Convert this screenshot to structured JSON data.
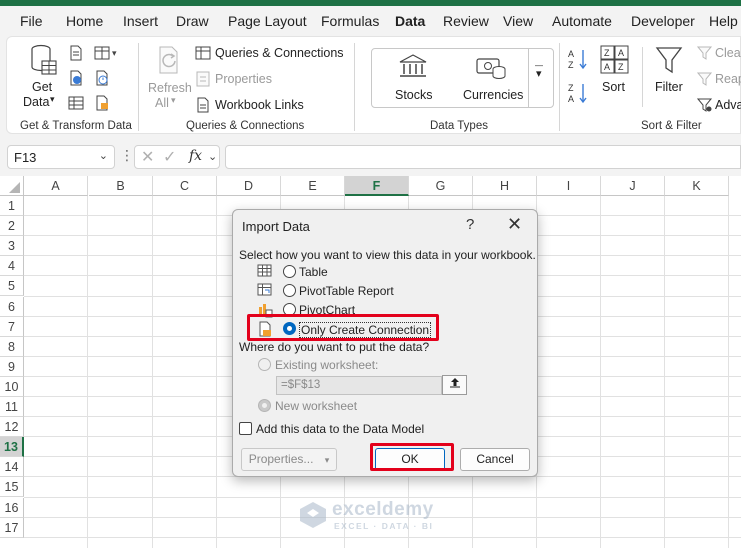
{
  "menu": {
    "tabs": [
      "File",
      "Home",
      "Insert",
      "Draw",
      "Page Layout",
      "Formulas",
      "Data",
      "Review",
      "View",
      "Automate",
      "Developer",
      "Help"
    ],
    "active_tab": "Data",
    "accent_color": "#1e7145"
  },
  "ribbon": {
    "get_transform": {
      "get_data_label": "Get",
      "get_data_label2": "Data",
      "group_label": "Get & Transform Data"
    },
    "queries": {
      "refresh_label": "Refresh",
      "refresh_all_label": "All",
      "queries_connections": "Queries & Connections",
      "properties": "Properties",
      "workbook_links": "Workbook Links",
      "group_label": "Queries & Connections"
    },
    "data_types": {
      "stocks": "Stocks",
      "currencies": "Currencies",
      "group_label": "Data Types"
    },
    "sort_filter": {
      "sort": "Sort",
      "filter": "Filter",
      "clear": "Clear",
      "reapply": "Reap",
      "advanced": "Adva",
      "group_label": "Sort & Filter"
    }
  },
  "formula_bar": {
    "name_box": "F13",
    "fx": "fx",
    "formula": ""
  },
  "grid": {
    "columns": [
      "A",
      "B",
      "C",
      "D",
      "E",
      "F",
      "G",
      "H",
      "I",
      "J",
      "K"
    ],
    "rows": [
      "1",
      "2",
      "3",
      "4",
      "5",
      "6",
      "7",
      "8",
      "9",
      "10",
      "11",
      "12",
      "13",
      "14",
      "15",
      "16",
      "17"
    ],
    "selected_column": "F",
    "selected_row": "13"
  },
  "dialog": {
    "title": "Import Data",
    "help": "?",
    "close": "✕",
    "view_prompt": "Select how you want to view this data in your workbook.",
    "view_options": [
      "Table",
      "PivotTable Report",
      "PivotChart",
      "Only Create Connection"
    ],
    "selected_view": "Only Create Connection",
    "place_prompt": "Where do you want to put the data?",
    "existing_worksheet": "Existing worksheet:",
    "reference": "=$F$13",
    "new_worksheet": "New worksheet",
    "data_model": "Add this data to the Data Model",
    "properties_button": "Properties...",
    "ok_button": "OK",
    "cancel_button": "Cancel",
    "highlight_color": "#e3001b"
  },
  "watermark": {
    "name": "exceldemy",
    "tagline": "EXCEL · DATA · BI"
  }
}
